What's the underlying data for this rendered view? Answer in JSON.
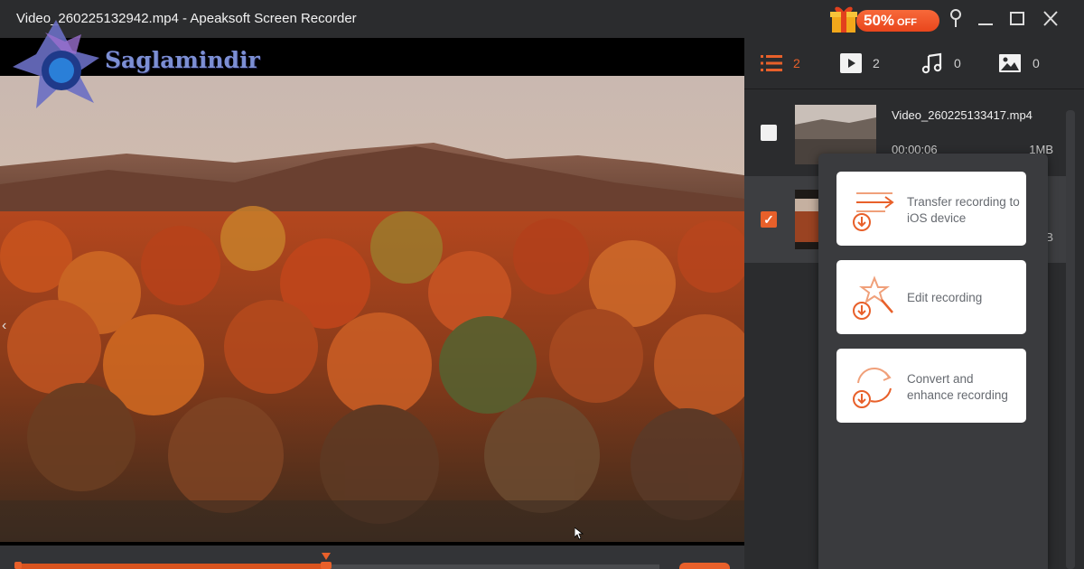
{
  "window": {
    "title": "Video_260225132942.mp4  -  Apeaksoft Screen Recorder",
    "promo_text": "50%",
    "promo_suffix": "OFF"
  },
  "watermark": {
    "text": "Saglamindir"
  },
  "tabs": [
    {
      "icon": "list-icon",
      "count": "2"
    },
    {
      "icon": "video-play-icon",
      "count": "2"
    },
    {
      "icon": "music-note-icon",
      "count": "0"
    },
    {
      "icon": "image-icon",
      "count": "0"
    }
  ],
  "recordings": [
    {
      "name": "Video_260225133417.mp4",
      "duration": "00:00:06",
      "size": "1MB",
      "checked": false
    },
    {
      "name": "",
      "duration": "",
      "size": "MB",
      "checked": true
    }
  ],
  "popup_menu": {
    "items": [
      {
        "label": "Transfer recording to iOS device",
        "icon": "transfer-icon"
      },
      {
        "label": "Edit recording",
        "icon": "magic-wand-icon"
      },
      {
        "label": "Convert and enhance recording",
        "icon": "convert-icon"
      }
    ]
  },
  "timeline": {
    "progress": 0.48
  },
  "colors": {
    "accent": "#e8602a",
    "background": "#2b2c2e",
    "panel": "#3a3b3e"
  }
}
